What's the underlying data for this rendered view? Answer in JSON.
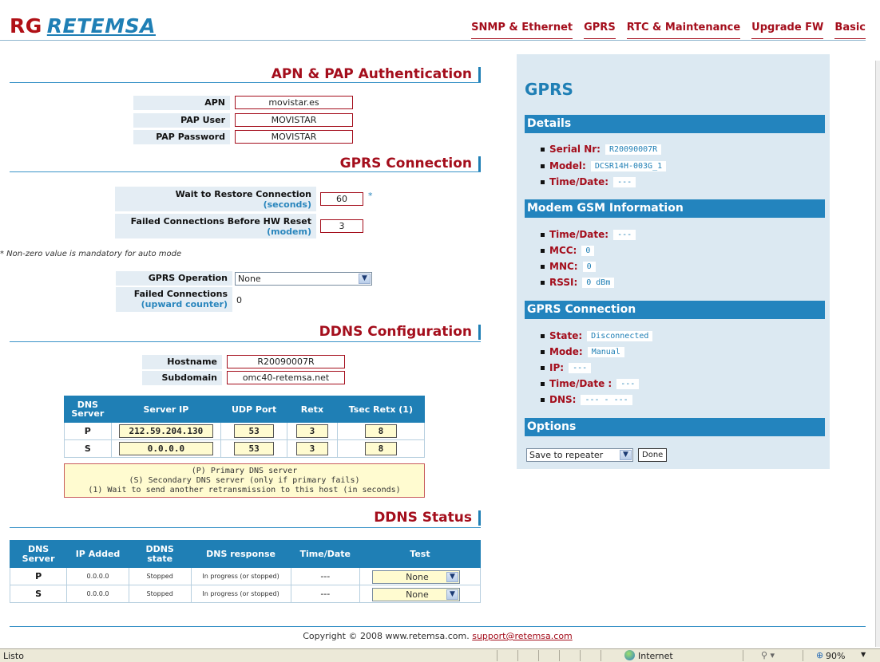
{
  "logo": {
    "rg": "RG",
    "brand": "RETEMSA"
  },
  "nav": [
    "SNMP & Ethernet",
    "GPRS",
    "RTC & Maintenance",
    "Upgrade FW",
    "Basic"
  ],
  "apn": {
    "title": "APN & PAP Authentication",
    "fields": [
      {
        "label": "APN",
        "value": "movistar.es"
      },
      {
        "label": "PAP User",
        "value": "MOVISTAR"
      },
      {
        "label": "PAP Password",
        "value": "MOVISTAR"
      }
    ]
  },
  "gprs_conn": {
    "title": "GPRS Connection",
    "wait_label": "Wait to Restore Connection",
    "wait_sub": "(seconds)",
    "wait_value": "60",
    "wait_mark": "*",
    "failed_label": "Failed Connections Before HW Reset",
    "failed_sub": "(modem)",
    "failed_value": "3",
    "note": "* Non-zero value is mandatory for auto mode",
    "op_label": "GPRS Operation",
    "op_value": "None",
    "fc_label": "Failed Connections",
    "fc_sub": "(upward counter)",
    "fc_value": "0"
  },
  "ddns": {
    "title": "DDNS Configuration",
    "hostname_label": "Hostname",
    "hostname_value": "R20090007R",
    "subdomain_label": "Subdomain",
    "subdomain_value": "omc40-retemsa.net",
    "headers": [
      "DNS Server",
      "Server IP",
      "UDP Port",
      "Retx",
      "Tsec Retx (1)"
    ],
    "rows": [
      {
        "server": "P",
        "ip": "212.59.204.130",
        "port": "53",
        "retx": "3",
        "tsec": "8"
      },
      {
        "server": "S",
        "ip": "0.0.0.0",
        "port": "53",
        "retx": "3",
        "tsec": "8"
      }
    ],
    "notes": [
      "(P) Primary DNS server",
      "(S) Secondary DNS server (only if primary fails)",
      "(1) Wait to send another retransmission to this host (in seconds)"
    ]
  },
  "status": {
    "title": "DDNS Status",
    "headers": [
      "DNS Server",
      "IP Added",
      "DDNS state",
      "DNS response",
      "Time/Date",
      "Test"
    ],
    "rows": [
      {
        "server": "P",
        "ip": "0.0.0.0",
        "state": "Stopped",
        "response": "In progress (or stopped)",
        "time": "---",
        "test": "None"
      },
      {
        "server": "S",
        "ip": "0.0.0.0",
        "state": "Stopped",
        "response": "In progress (or stopped)",
        "time": "---",
        "test": "None"
      }
    ]
  },
  "panel": {
    "title": "GPRS",
    "details_title": "Details",
    "details": [
      {
        "label": "Serial Nr:",
        "value": "R20090007R"
      },
      {
        "label": "Model:",
        "value": "DCSR14H-003G_1"
      },
      {
        "label": "Time/Date:",
        "value": "---"
      }
    ],
    "modem_title": "Modem GSM Information",
    "modem": [
      {
        "label": "Time/Date:",
        "value": "---"
      },
      {
        "label": "MCC:",
        "value": "0"
      },
      {
        "label": "MNC:",
        "value": "0"
      },
      {
        "label": "RSSI:",
        "value": "0 dBm"
      }
    ],
    "conn_title": "GPRS Connection",
    "conn": [
      {
        "label": "State:",
        "value": "Disconnected"
      },
      {
        "label": "Mode:",
        "value": "Manual"
      },
      {
        "label": "IP:",
        "value": "---"
      },
      {
        "label": "Time/Date :",
        "value": "---"
      },
      {
        "label": "DNS:",
        "value": "--- - ---"
      }
    ],
    "options_title": "Options",
    "options_select": "Save to repeater",
    "done_label": "Done"
  },
  "footer": {
    "copyright": "Copyright © 2008 www.retemsa.com.",
    "email": "support@retemsa.com"
  },
  "statusbar": {
    "left": "Listo",
    "zone": "Internet",
    "zoom": "90%"
  }
}
